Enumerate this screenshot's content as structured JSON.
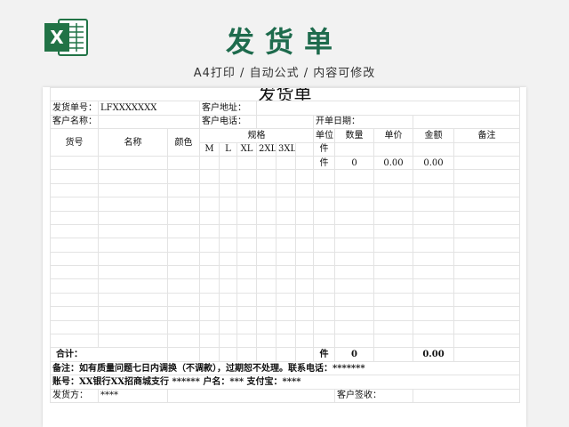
{
  "header": {
    "logo_letter": "X",
    "title": "发货单",
    "subtitle": "A4打印 / 自动公式 / 内容可修改"
  },
  "form": {
    "doc_title": "发货单",
    "order_no_label": "发货单号：",
    "order_no_value": "LFXXXXXXX",
    "address_label": "客户地址：",
    "customer_name_label": "客户名称：",
    "phone_label": "客户电话：",
    "date_label": "开单日期：",
    "columns": {
      "item_no": "货号",
      "name": "名称",
      "color": "颜色",
      "spec": "规格",
      "sizes": [
        "M",
        "L",
        "XL",
        "2XL",
        "3XL"
      ],
      "unit": "单位",
      "qty": "数量",
      "price": "单价",
      "amount": "金额",
      "notes": "备注"
    },
    "unit_row1": "件",
    "first_row": {
      "unit": "件",
      "qty": "0",
      "price": "0.00",
      "amount": "0.00"
    },
    "total": {
      "label": "合计：",
      "unit": "件",
      "qty": "0",
      "amount": "0.00"
    },
    "note_text": "备注：如有质量问题七日内调换（不调款），过期恕不处理。联系电话：*******",
    "account_text": "账号：XX银行XX招商城支行 ****** 户名：*** 支付宝：****",
    "shipper_label": "发货方：",
    "shipper_value": "****",
    "receiver_label": "客户签收："
  },
  "colors": {
    "brand_green": "#1e6b4d",
    "excel_green": "#217346"
  }
}
